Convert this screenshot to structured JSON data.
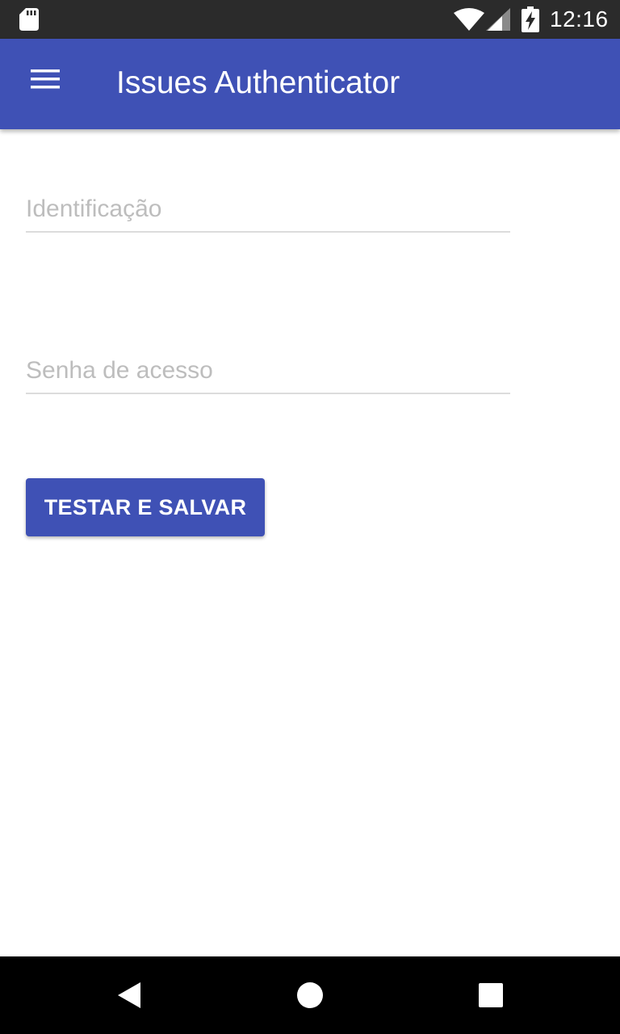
{
  "status_bar": {
    "time": "12:16",
    "icons": [
      "sd-card-icon",
      "wifi-icon",
      "signal-icon",
      "battery-charging-icon"
    ]
  },
  "app_bar": {
    "title": "Issues Authenticator",
    "menu_icon": "hamburger-menu-icon",
    "background_color": "#3f51b5"
  },
  "form": {
    "identification": {
      "placeholder": "Identificação",
      "value": ""
    },
    "password": {
      "placeholder": "Senha de acesso",
      "value": ""
    },
    "submit_label": "TESTAR E SALVAR"
  },
  "nav_bar": {
    "icons": [
      "back-icon",
      "home-icon",
      "recents-icon"
    ]
  }
}
